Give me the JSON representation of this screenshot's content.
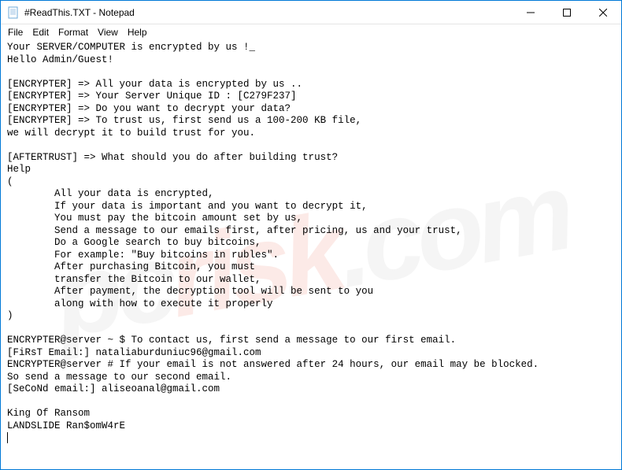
{
  "window": {
    "title": "#ReadThis.TXT - Notepad"
  },
  "menu": {
    "file": "File",
    "edit": "Edit",
    "format": "Format",
    "view": "View",
    "help": "Help"
  },
  "content": {
    "l0": "Your SERVER/COMPUTER is encrypted by us !_",
    "l1": "Hello Admin/Guest!",
    "l2": "",
    "l3": "[ENCRYPTER] => All your data is encrypted by us ..",
    "l4": "[ENCRYPTER] => Your Server Unique ID : [C279F237]",
    "l5": "[ENCRYPTER] => Do you want to decrypt your data?",
    "l6": "[ENCRYPTER] => To trust us, first send us a 100-200 KB file,",
    "l7": "we will decrypt it to build trust for you.",
    "l8": "",
    "l9": "[AFTERTRUST] => What should you do after building trust?",
    "l10": "Help",
    "l11": "(",
    "l12": "        All your data is encrypted,",
    "l13": "        If your data is important and you want to decrypt it,",
    "l14": "        You must pay the bitcoin amount set by us,",
    "l15": "        Send a message to our emails first, after pricing, us and your trust,",
    "l16": "        Do a Google search to buy bitcoins,",
    "l17": "        For example: \"Buy bitcoins in rubles\".",
    "l18": "        After purchasing Bitcoin, you must",
    "l19": "        transfer the Bitcoin to our wallet,",
    "l20": "        After payment, the decryption tool will be sent to you",
    "l21": "        along with how to execute it properly",
    "l22": ")",
    "l23": "",
    "l24": "ENCRYPTER@server ~ $ To contact us, first send a message to our first email.",
    "l25": "[FiRsT Email:] nataliaburduniuc96@gmail.com",
    "l26": "ENCRYPTER@server # If your email is not answered after 24 hours, our email may be blocked.",
    "l27": "So send a message to our second email.",
    "l28": "[SeCoNd email:] aliseoanal@gmail.com",
    "l29": "",
    "l30": "King Of Ransom",
    "l31": "LANDSLIDE Ran$omW4rE"
  },
  "watermark": {
    "text1": "pc",
    "text2": "risk",
    "text3": ".com"
  }
}
